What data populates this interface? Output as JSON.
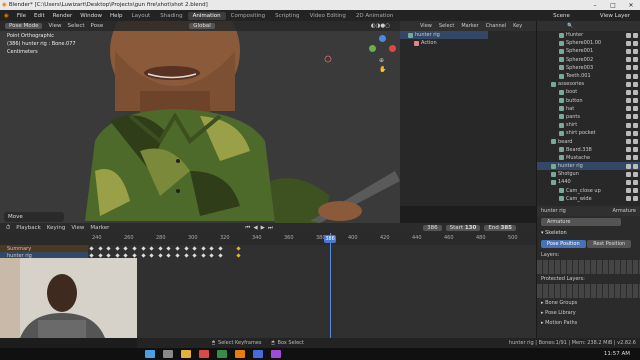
{
  "window": {
    "title": "Blender* [C:\\Users\\Luwizart\\Desktop\\Projects\\gun fire\\shot\\shot 2.blend]",
    "buttons": [
      "–",
      "□",
      "✕"
    ]
  },
  "menu": [
    "File",
    "Edit",
    "Render",
    "Window",
    "Help"
  ],
  "workspace_tabs": [
    "Layout",
    "Shading",
    "Animation",
    "Compositing",
    "Scripting",
    "Video Editing",
    "2D Animation"
  ],
  "active_tab": "Animation",
  "scene": {
    "label": "Scene",
    "view_layer": "View Layer"
  },
  "viewport": {
    "mode": "Pose Mode",
    "menus": [
      "View",
      "Select",
      "Pose"
    ],
    "orientation": "Global",
    "info": [
      "Point Orthographic",
      "(386) hunter rig : Bone.077",
      "Centimeters"
    ],
    "move_panel": "Move",
    "colors": {
      "skin": "#8a5a3a",
      "jacket_green": "#4e6a2a",
      "camo_dark": "#2f3d18",
      "camo_light": "#9aa048",
      "gun": "#5a5a5a",
      "bg": "#3a3a3a"
    }
  },
  "dopesheet_mini": {
    "menus": [
      "View",
      "Select",
      "Marker",
      "Channel",
      "Key"
    ],
    "rows": [
      "hunter rig",
      "Action"
    ]
  },
  "outliner": {
    "items": [
      {
        "label": "Hunter",
        "indent": 2
      },
      {
        "label": "Sphere001.00",
        "indent": 2
      },
      {
        "label": "Sphere001",
        "indent": 2
      },
      {
        "label": "Sphere002",
        "indent": 2
      },
      {
        "label": "Sphere003",
        "indent": 2
      },
      {
        "label": "Teeth.001",
        "indent": 2
      },
      {
        "label": "assesories",
        "indent": 1
      },
      {
        "label": "boot",
        "indent": 2
      },
      {
        "label": "button",
        "indent": 2
      },
      {
        "label": "hat",
        "indent": 2
      },
      {
        "label": "pants",
        "indent": 2
      },
      {
        "label": "shirt",
        "indent": 2
      },
      {
        "label": "shirt pocket",
        "indent": 2
      },
      {
        "label": "beard",
        "indent": 1
      },
      {
        "label": "Beard.338",
        "indent": 2
      },
      {
        "label": "Mustache",
        "indent": 2
      },
      {
        "label": "hunter rig",
        "indent": 1,
        "selected": true
      },
      {
        "label": "Shotgun",
        "indent": 1
      },
      {
        "label": "1440",
        "indent": 1
      },
      {
        "label": "Cam_close up",
        "indent": 2
      },
      {
        "label": "Cam_wide",
        "indent": 2
      }
    ]
  },
  "timeline": {
    "menus": [
      "Playback",
      "Keying",
      "View",
      "Marker"
    ],
    "current_frame": "386",
    "start_label": "Start",
    "start": "130",
    "end_label": "End",
    "end": "385",
    "ruler": [
      "240",
      "260",
      "280",
      "300",
      "320",
      "340",
      "360",
      "380",
      "400",
      "420",
      "440",
      "460",
      "480",
      "500",
      "520"
    ],
    "channels": [
      "Summary",
      "hunter rig"
    ],
    "playhead_frame": 386
  },
  "properties": {
    "object": "hunter rig",
    "data": "Armature",
    "data_name": "Armature",
    "sections": [
      "Skeleton",
      "Bone Groups",
      "Pose Library",
      "Motion Paths"
    ],
    "pose_position": "Pose Position",
    "rest_position": "Rest Position",
    "layers_label": "Layers:",
    "protected_label": "Protected Layers:"
  },
  "status": {
    "select": "Select Keyframes",
    "box": "Box Select",
    "info": "hunter rig | Bones:1/91 | Mem: 238.2 MiB | v2.82.6"
  },
  "taskbar": {
    "time": "11:57 AM"
  }
}
